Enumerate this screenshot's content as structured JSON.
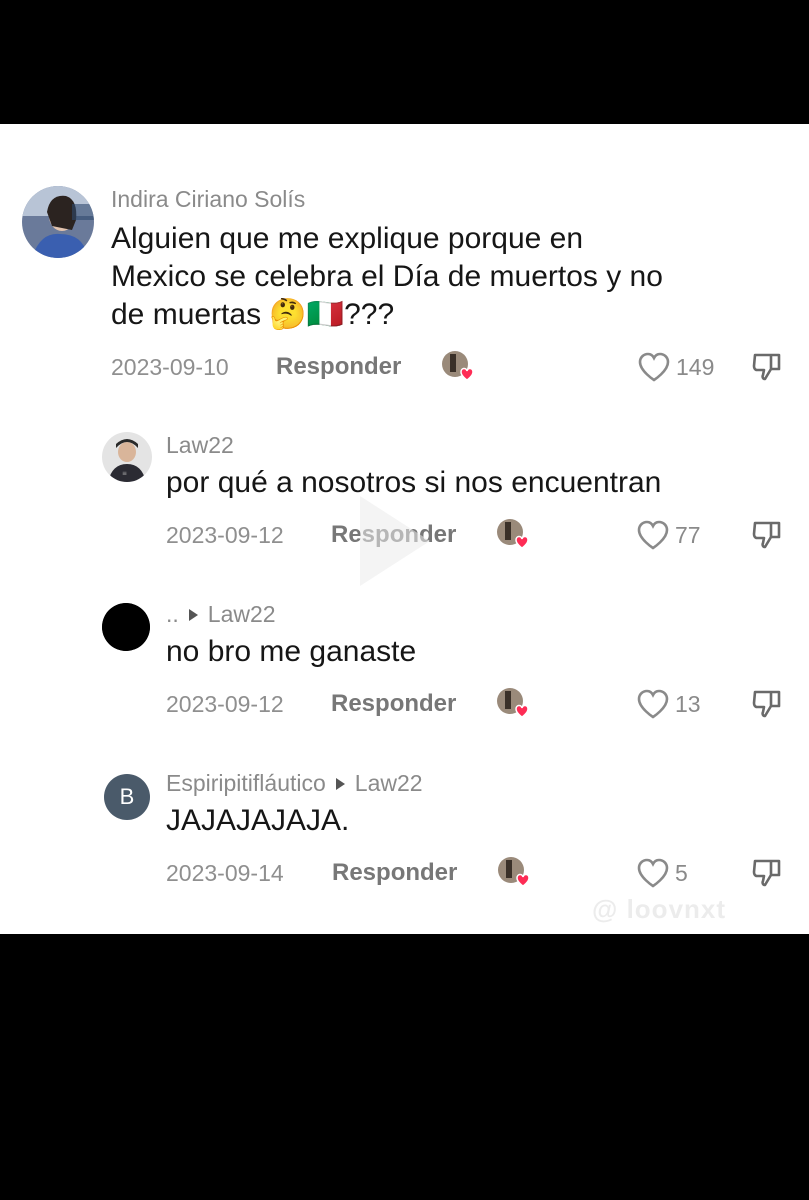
{
  "comments": [
    {
      "username": "Indira Ciriano Solís",
      "reply_to": "",
      "text_lines": [
        "Alguien que me explique porque en",
        "Mexico se celebra el Día de muertos y no",
        "de muertas 🤔🇮🇹???"
      ],
      "date": "2023-09-10",
      "reply_label": "Responder",
      "likes": "149",
      "avatar_icon": "profile-photo"
    },
    {
      "username": "Law22",
      "reply_to": "",
      "text_lines": [
        "por qué a nosotros si nos encuentran"
      ],
      "date": "2023-09-12",
      "reply_label": "Responder",
      "likes": "77",
      "avatar_icon": "profile-photo"
    },
    {
      "username": "..",
      "reply_to": "Law22",
      "text_lines": [
        "no bro me ganaste"
      ],
      "date": "2023-09-12",
      "reply_label": "Responder",
      "likes": "13",
      "avatar_icon": "black-circle"
    },
    {
      "username": "Espiripitifláutico",
      "reply_to": "Law22",
      "avatar_letter": "B",
      "text_lines": [
        "JAJAJAJAJA."
      ],
      "date": "2023-09-14",
      "reply_label": "Responder",
      "likes": "5",
      "avatar_icon": "letter-avatar"
    }
  ],
  "watermark": "@ loovnxt",
  "colors": {
    "background": "#000000",
    "panel": "#ffffff",
    "heart_badge": "#fe2c55",
    "letter_avatar": "#4a5a6a"
  }
}
